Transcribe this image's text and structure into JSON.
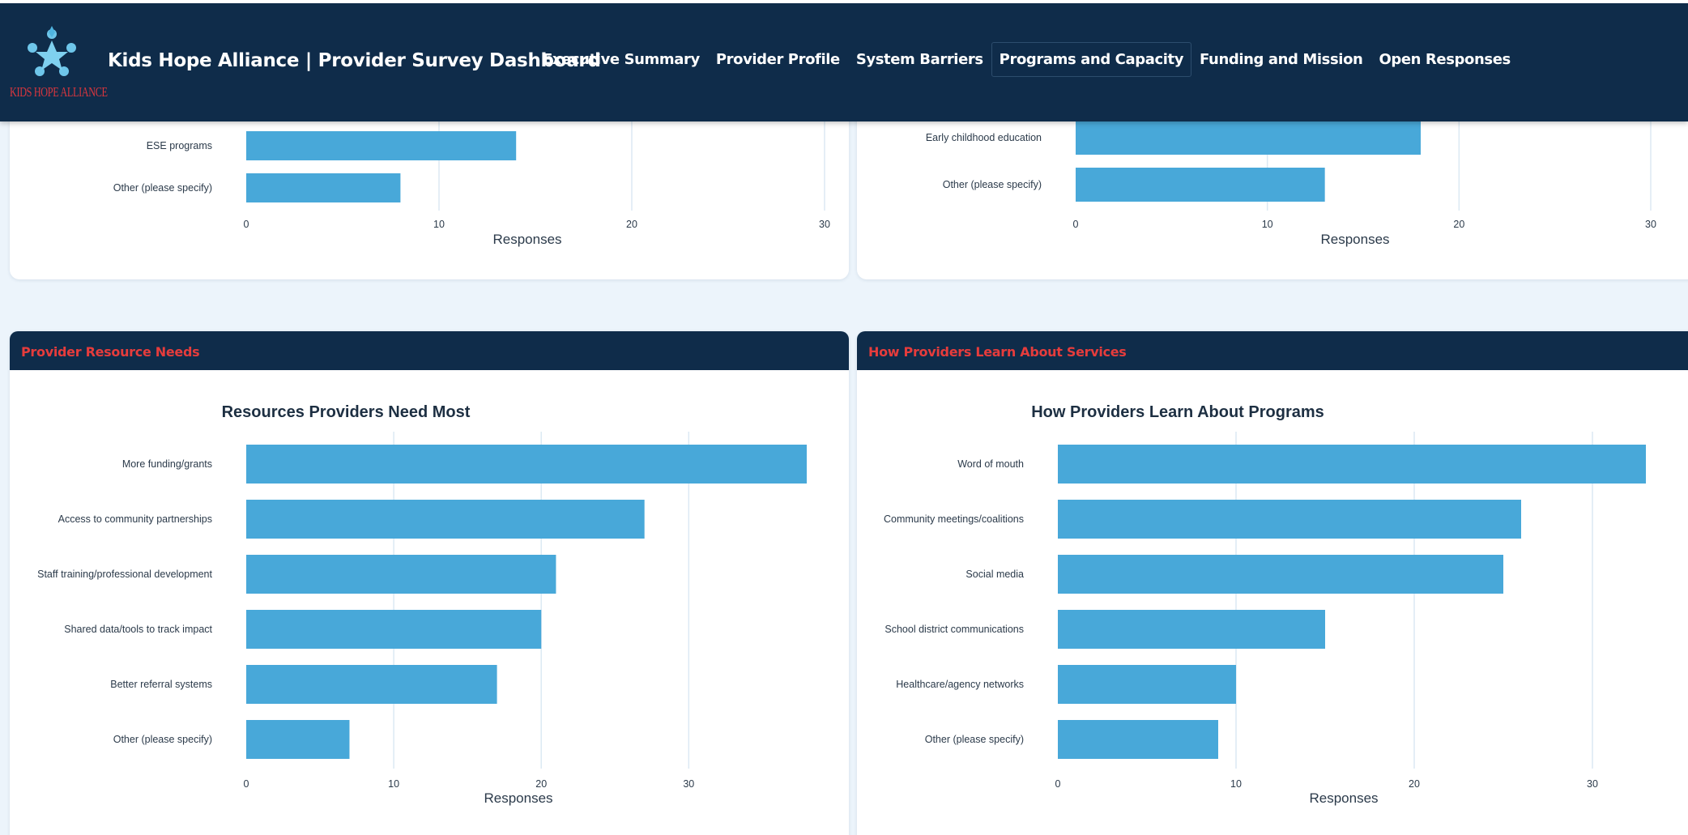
{
  "header": {
    "logo_text": "KIDS HOPE ALLIANCE",
    "title": "Kids Hope Alliance | Provider Survey Dashboard",
    "nav": [
      {
        "label": "Executive Summary"
      },
      {
        "label": "Provider Profile"
      },
      {
        "label": "System Barriers"
      },
      {
        "label": "Programs and Capacity",
        "active": true
      },
      {
        "label": "Funding and Mission"
      },
      {
        "label": "Open Responses"
      }
    ],
    "logo_icon": "star-people-logo",
    "colors": {
      "navy": "#0f2c4a",
      "accent_red": "#e63c3c",
      "bar": "#48a8d9"
    }
  },
  "cards": {
    "top_left": {},
    "top_right": {},
    "bottom_left": {
      "header": "Provider Resource Needs"
    },
    "bottom_right": {
      "header": "How Providers Learn About Services"
    }
  },
  "chart_data": [
    {
      "type": "bar",
      "orientation": "horizontal",
      "title": "",
      "categories": [
        "ESE programs",
        "Other (please specify)"
      ],
      "values": [
        14,
        8
      ],
      "xlabel": "Responses",
      "xlim": [
        0,
        30
      ],
      "xticks": [
        0,
        10,
        20,
        30
      ],
      "grid": true,
      "partially_visible": true
    },
    {
      "type": "bar",
      "orientation": "horizontal",
      "title": "",
      "categories": [
        "Early childhood education",
        "Other (please specify)"
      ],
      "values": [
        18,
        13
      ],
      "xlabel": "Responses",
      "xlim": [
        0,
        30
      ],
      "xticks": [
        0,
        10,
        20,
        30
      ],
      "grid": true,
      "partially_visible": true
    },
    {
      "type": "bar",
      "orientation": "horizontal",
      "title": "Resources Providers Need Most",
      "categories": [
        "More funding/grants",
        "Access to community partnerships",
        "Staff training/professional development",
        "Shared data/tools to track impact",
        "Better referral systems",
        "Other (please specify)"
      ],
      "values": [
        38,
        27,
        21,
        20,
        17,
        7
      ],
      "xlabel": "Responses",
      "xlim": [
        0,
        38
      ],
      "xticks": [
        0,
        10,
        20,
        30
      ],
      "grid": true
    },
    {
      "type": "bar",
      "orientation": "horizontal",
      "title": "How Providers Learn About Programs",
      "categories": [
        "Word of mouth",
        "Community meetings/coalitions",
        "Social media",
        "School district communications",
        "Healthcare/agency networks",
        "Other (please specify)"
      ],
      "values": [
        33,
        26,
        25,
        15,
        10,
        9
      ],
      "xlabel": "Responses",
      "xlim": [
        0,
        33
      ],
      "xticks": [
        0,
        10,
        20,
        30
      ],
      "grid": true
    }
  ]
}
